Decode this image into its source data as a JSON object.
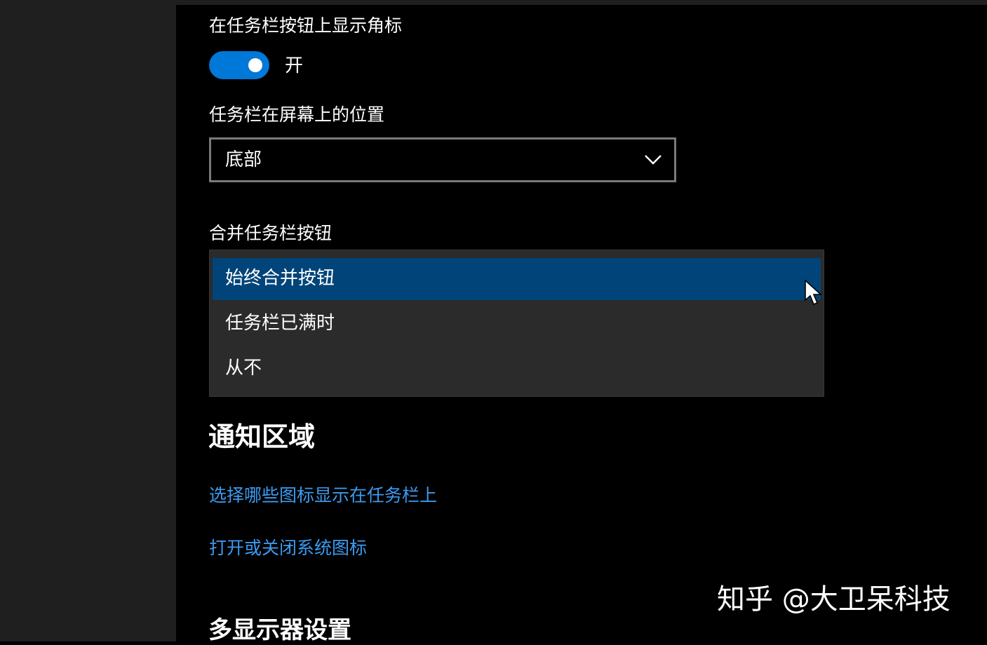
{
  "badges": {
    "label": "在任务栏按钮上显示角标",
    "toggle_state": "开",
    "toggle_on": true,
    "accent_color": "#0078d7"
  },
  "position": {
    "label": "任务栏在屏幕上的位置",
    "value": "底部"
  },
  "combine": {
    "label": "合并任务栏按钮",
    "options": [
      {
        "label": "始终合并按钮",
        "selected": true
      },
      {
        "label": "任务栏已满时",
        "selected": false
      },
      {
        "label": "从不",
        "selected": false
      }
    ],
    "selected_color": "#004479"
  },
  "notification_area": {
    "title": "通知区域",
    "links": [
      "选择哪些图标显示在任务栏上",
      "打开或关闭系统图标"
    ],
    "link_color": "#3c9bf0"
  },
  "multi_display": {
    "title": "多显示器设置"
  },
  "watermark": {
    "text": "知乎 @大卫呆科技"
  }
}
